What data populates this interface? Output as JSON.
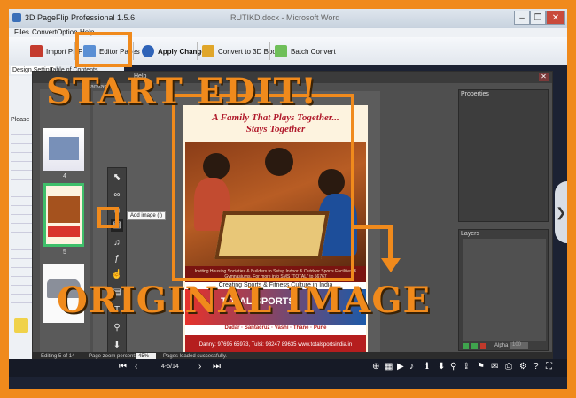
{
  "window": {
    "title": "3D PageFlip Professional 1.5.6",
    "center_title": "RUTIKD.docx - Microsoft Word",
    "minimize": "–",
    "restore": "❐",
    "close": "✕"
  },
  "menu": [
    "Files",
    "Convert",
    "Option",
    "Help"
  ],
  "toolbar": {
    "import_pdf": "Import PDF",
    "editor_pages": "Editor Pages",
    "apply_change": "Apply Change",
    "convert_3d": "Convert to 3D Book",
    "batch_convert": "Batch Convert"
  },
  "tabs": [
    "Design Setting",
    "Table of Contents"
  ],
  "left_panel": {
    "please": "Please"
  },
  "editor": {
    "help": "Help",
    "canvas": "Canvas",
    "close": "✕",
    "thumb_numbers": [
      "4",
      "5"
    ],
    "tooltip": "Add image (I)",
    "properties": "Properties",
    "layers": "Layers",
    "alpha_label": "Alpha",
    "alpha_value": "100"
  },
  "page": {
    "headline_line1": "A Family That Plays Together...",
    "headline_line2": "Stays Together",
    "caption": "Inviting Housing Societies & Builders to Setup Indoor & Outdoor Sports Facilities & Gymnasiums. For more info SMS \"TOTAL\" to 56767",
    "creating_line": "Creating Sports & Fitness Culture in India",
    "sports_brand": "TOTAL SPORTS",
    "locations": "Dadar · Santacruz · Vashi · Thane · Pune",
    "contact": "Danny: 97695 65973, Tulsi: 93247 89635   www.totalsportsindia.in"
  },
  "status": {
    "editing": "Editing 5 of 14",
    "zoom_label": "Page zoom percent:",
    "zoom_value": "45%",
    "loaded": "Pages loaded successfully."
  },
  "nav": {
    "page_indicator": "4-5/14"
  },
  "annotations": {
    "start_edit": "START EDIT!",
    "original_image": "ORIGINAL IMAGE"
  },
  "colors": {
    "annotation_orange": "#f08a1c",
    "editor_gray": "#4f4f4f",
    "headline_red": "#b0182a"
  }
}
